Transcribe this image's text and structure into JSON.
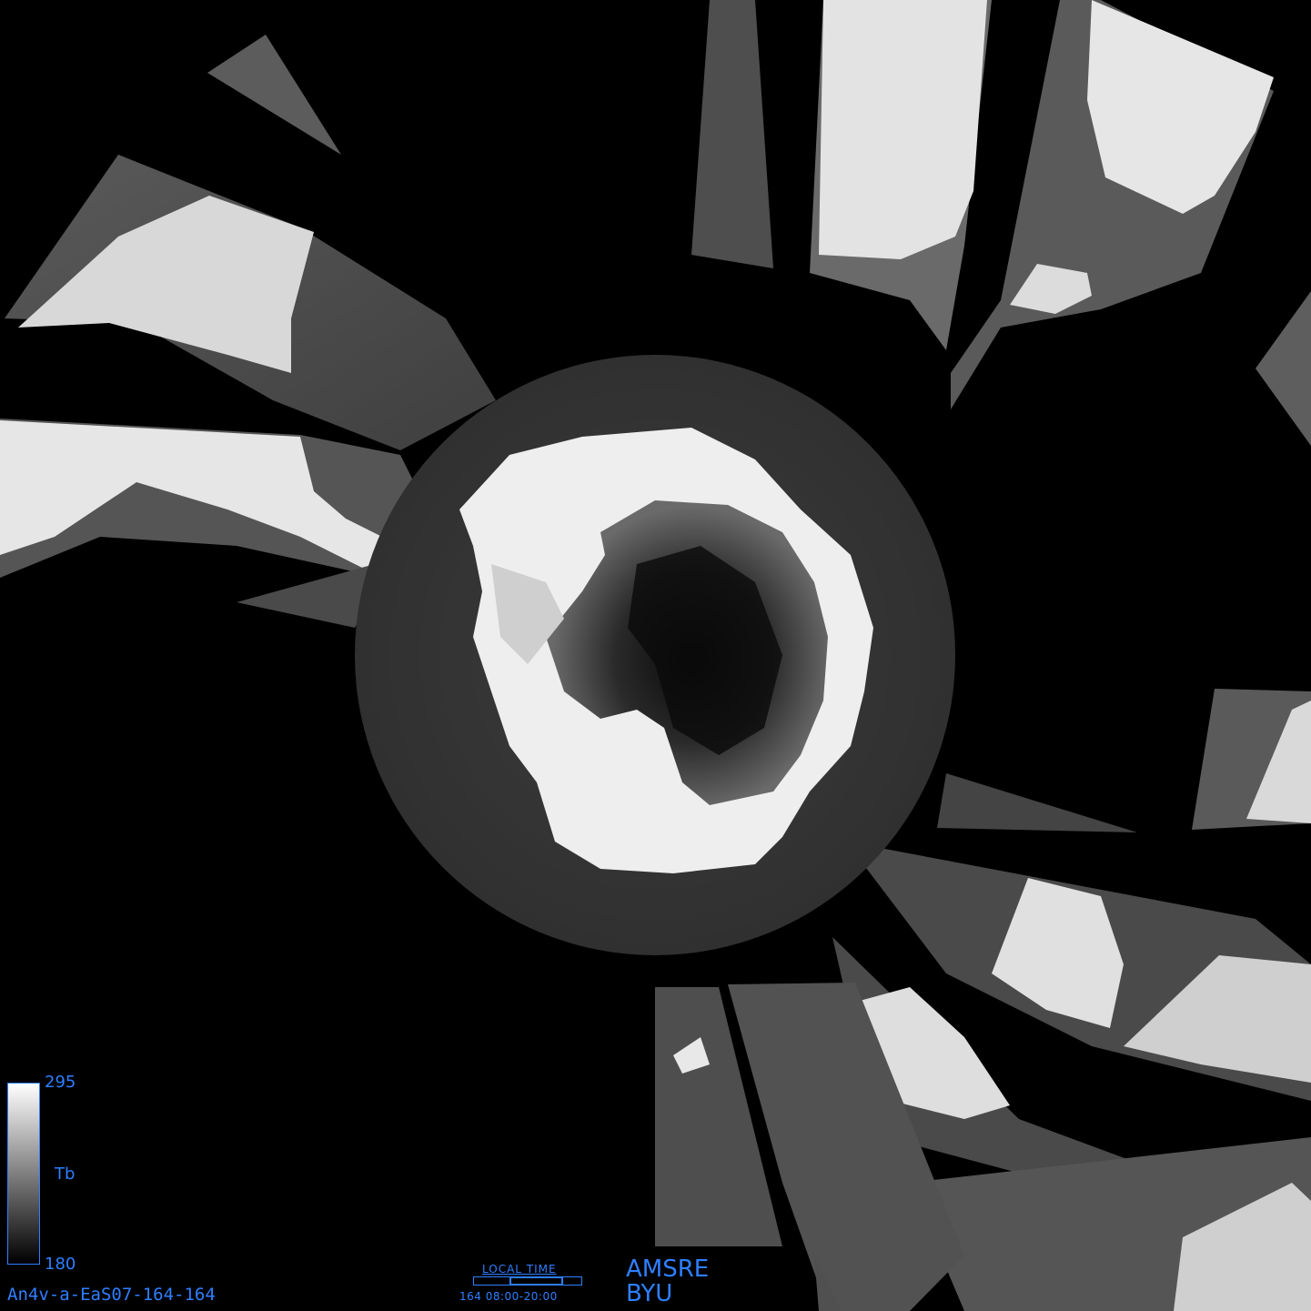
{
  "colorbar": {
    "max_label": "295",
    "min_label": "180",
    "variable_label": "Tb",
    "max_value": 295,
    "min_value": 180
  },
  "file_id": "An4v-a-EaS07-164-164",
  "local_time": {
    "title": "LOCAL TIME",
    "range": "164 08:00-20:00",
    "window_start_fraction": 0.333,
    "window_end_fraction": 0.833
  },
  "sensor": "AMSRE",
  "organization": "BYU",
  "colors": {
    "annotation": "#2f7fff",
    "background": "#000000",
    "ice_sheet": "#f2f2f2",
    "ocean": "#3a3a3a"
  }
}
